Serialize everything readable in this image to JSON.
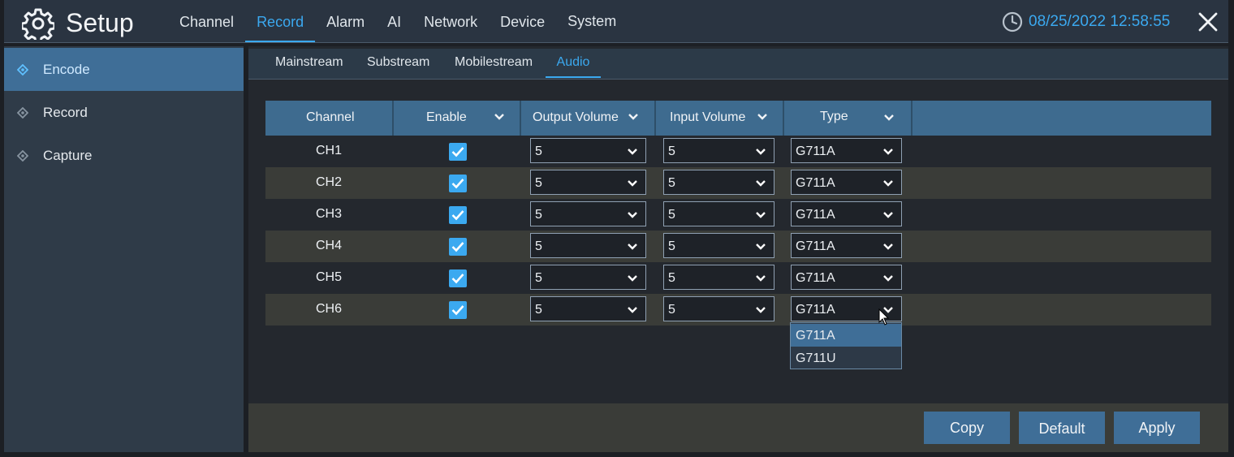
{
  "header": {
    "title": "Setup",
    "nav": [
      "Channel",
      "Record",
      "Alarm",
      "AI",
      "Network",
      "Device",
      "System"
    ],
    "active_nav": "Record",
    "datetime": "08/25/2022 12:58:55",
    "accent": "#3ba9f0"
  },
  "sidebar": {
    "items": [
      {
        "label": "Encode",
        "active": true
      },
      {
        "label": "Record",
        "active": false
      },
      {
        "label": "Capture",
        "active": false
      }
    ]
  },
  "subtabs": {
    "items": [
      "Mainstream",
      "Substream",
      "Mobilestream",
      "Audio"
    ],
    "active": "Audio"
  },
  "table": {
    "headers": [
      "Channel",
      "Enable",
      "Output Volume",
      "Input Volume",
      "Type"
    ],
    "rows": [
      {
        "channel": "CH1",
        "enabled": true,
        "output_volume": "5",
        "input_volume": "5",
        "type": "G711A"
      },
      {
        "channel": "CH2",
        "enabled": true,
        "output_volume": "5",
        "input_volume": "5",
        "type": "G711A"
      },
      {
        "channel": "CH3",
        "enabled": true,
        "output_volume": "5",
        "input_volume": "5",
        "type": "G711A"
      },
      {
        "channel": "CH4",
        "enabled": true,
        "output_volume": "5",
        "input_volume": "5",
        "type": "G711A"
      },
      {
        "channel": "CH5",
        "enabled": true,
        "output_volume": "5",
        "input_volume": "5",
        "type": "G711A"
      },
      {
        "channel": "CH6",
        "enabled": true,
        "output_volume": "5",
        "input_volume": "5",
        "type": "G711A"
      }
    ]
  },
  "type_dropdown": {
    "options": [
      "G711A",
      "G711U"
    ],
    "highlighted": "G711A"
  },
  "buttons": {
    "copy": "Copy",
    "default": "Default",
    "apply": "Apply"
  }
}
